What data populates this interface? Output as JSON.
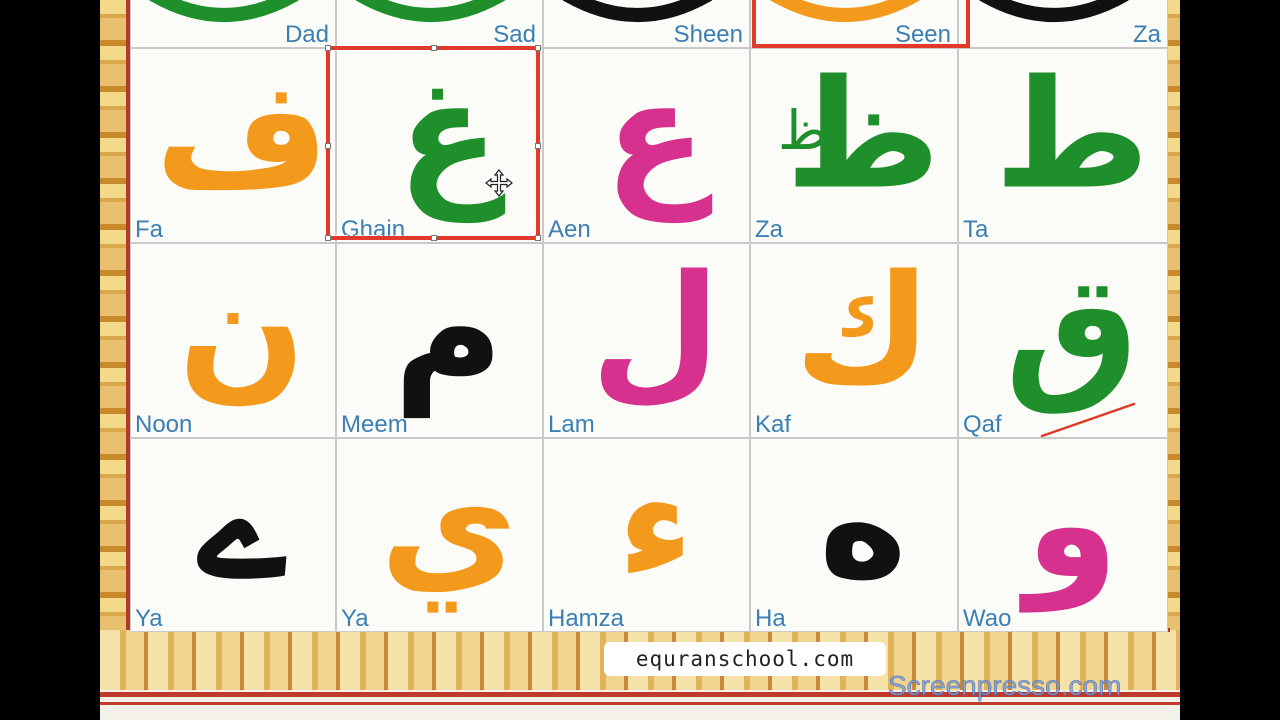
{
  "colors": {
    "green": "#1e8f2a",
    "orange": "#f39a1c",
    "magenta": "#d6318f",
    "black": "#111111",
    "label_blue": "#3b7fb5",
    "highlight_red": "#e23a2a"
  },
  "top_row": [
    {
      "name": "Dad",
      "color": "green"
    },
    {
      "name": "Sad",
      "color": "green"
    },
    {
      "name": "Sheen",
      "color": "black"
    },
    {
      "name": "Seen",
      "color": "orange",
      "highlighted": true
    },
    {
      "name": "Za",
      "color": "black"
    }
  ],
  "row1": [
    {
      "name": "Fa",
      "letter": "ف",
      "color": "orange"
    },
    {
      "name": "Ghain",
      "letter": "غ",
      "color": "green",
      "selected": true
    },
    {
      "name": "Aen",
      "letter": "ع",
      "color": "magenta"
    },
    {
      "name": "Za",
      "letter": "ظ",
      "small": "ظ",
      "color": "green"
    },
    {
      "name": "Ta",
      "letter": "ط",
      "color": "green"
    }
  ],
  "row2": [
    {
      "name": "Noon",
      "letter": "ن",
      "color": "orange"
    },
    {
      "name": "Meem",
      "letter": "م",
      "color": "black"
    },
    {
      "name": "Lam",
      "letter": "ل",
      "color": "magenta"
    },
    {
      "name": "Kaf",
      "letter": "ك",
      "color": "orange"
    },
    {
      "name": "Qaf",
      "letter": "ق",
      "color": "green"
    }
  ],
  "row3": [
    {
      "name": "Ya",
      "letter": "ے",
      "color": "black"
    },
    {
      "name": "Ya",
      "letter": "ي",
      "color": "orange"
    },
    {
      "name": "Hamza",
      "letter": "ء",
      "color": "orange"
    },
    {
      "name": "Ha",
      "letter": "ه",
      "color": "black"
    },
    {
      "name": "Wao",
      "letter": "و",
      "color": "magenta"
    }
  ],
  "footer": {
    "url": "equranschool.com",
    "watermark": "Screenpresso.com"
  },
  "icons": {
    "move": "move-cursor-icon",
    "annotation": "red-underline-annotation"
  }
}
